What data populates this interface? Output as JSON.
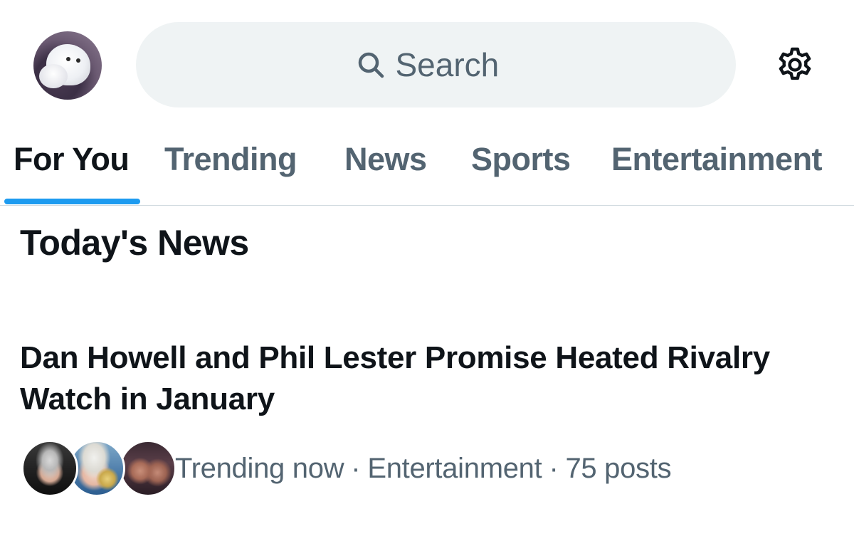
{
  "header": {
    "search": {
      "placeholder": "Search",
      "icon": "search-icon"
    },
    "settings_icon": "gear-icon"
  },
  "tabs": [
    {
      "label": "For You",
      "active": true
    },
    {
      "label": "Trending",
      "active": false
    },
    {
      "label": "News",
      "active": false
    },
    {
      "label": "Sports",
      "active": false
    },
    {
      "label": "Entertainment",
      "active": false
    }
  ],
  "section": {
    "title": "Today's News"
  },
  "story": {
    "headline": "Dan Howell and Phil Lester Promise Heated Rivalry Watch in January",
    "meta": {
      "status": "Trending now",
      "category": "Entertainment",
      "posts": "75 posts",
      "separator": "·"
    }
  },
  "colors": {
    "accent": "#1d9bf0",
    "text_primary": "#0f1419",
    "text_secondary": "#536471",
    "search_bg": "#eff3f4",
    "divider": "#cfd9de"
  }
}
